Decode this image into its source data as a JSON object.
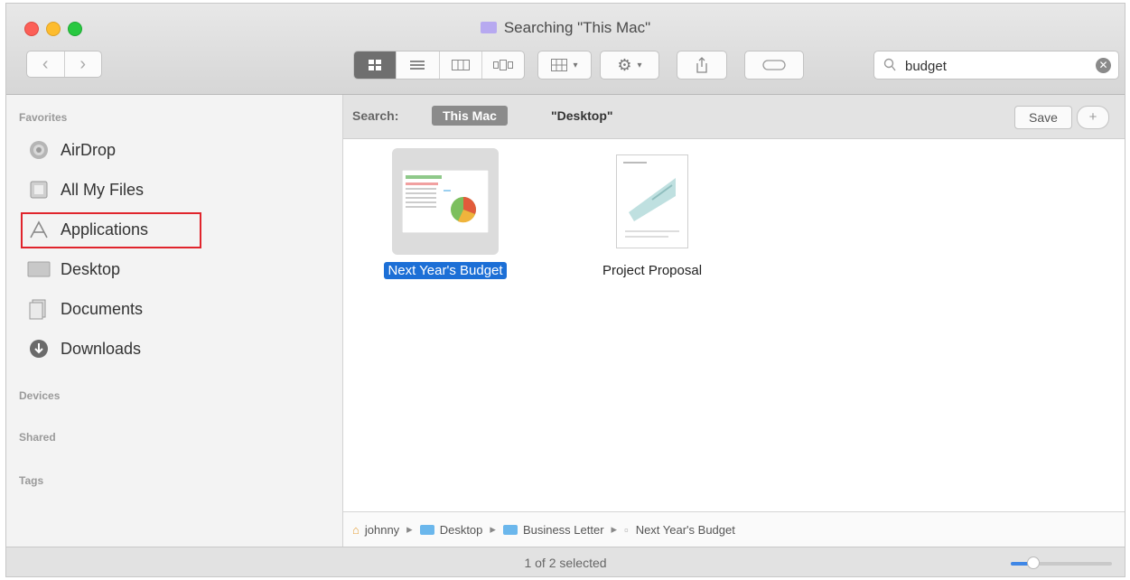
{
  "window": {
    "title": "Searching \"This Mac\""
  },
  "toolbar": {
    "search": {
      "value": "budget",
      "placeholder": ""
    }
  },
  "sidebar": {
    "sections": {
      "favorites": "Favorites",
      "devices": "Devices",
      "shared": "Shared",
      "tags": "Tags"
    },
    "items": [
      {
        "label": "AirDrop",
        "icon": "airdrop-icon"
      },
      {
        "label": "All My Files",
        "icon": "all-my-files-icon"
      },
      {
        "label": "Applications",
        "icon": "applications-icon"
      },
      {
        "label": "Desktop",
        "icon": "desktop-icon"
      },
      {
        "label": "Documents",
        "icon": "documents-icon"
      },
      {
        "label": "Downloads",
        "icon": "downloads-icon"
      }
    ]
  },
  "scope": {
    "label": "Search:",
    "this_mac": "This Mac",
    "location": "\"Desktop\"",
    "save": "Save",
    "add": "+"
  },
  "files": [
    {
      "name": "Next Year's Budget",
      "selected": true
    },
    {
      "name": "Project Proposal",
      "selected": false
    }
  ],
  "pathbar": {
    "items": [
      "johnny",
      "Desktop",
      "Business Letter",
      "Next Year's Budget"
    ]
  },
  "status": {
    "text": "1 of 2 selected",
    "icon_size_fraction": 0.22
  },
  "colors": {
    "selection": "#1c6fd6",
    "highlight_box": "#e0242c",
    "folder": "#6bb7ec"
  }
}
